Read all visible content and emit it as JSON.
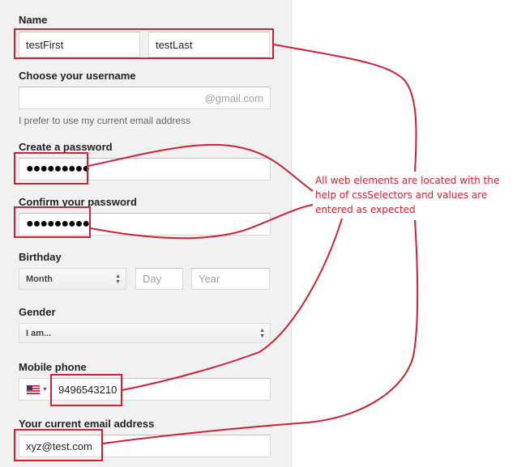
{
  "form": {
    "name": {
      "label": "Name",
      "first_value": "testFirst",
      "last_value": "testLast"
    },
    "username": {
      "label": "Choose your username",
      "suffix": "@gmail.com",
      "alt_link": "I prefer to use my current email address"
    },
    "password": {
      "label": "Create a password",
      "value": "●●●●●●●●●"
    },
    "confirm": {
      "label": "Confirm your password",
      "value": "●●●●●●●●●"
    },
    "birthday": {
      "label": "Birthday",
      "month": "Month",
      "day_placeholder": "Day",
      "year_placeholder": "Year"
    },
    "gender": {
      "label": "Gender",
      "value": "I am..."
    },
    "mobile": {
      "label": "Mobile phone",
      "value": "9496543210"
    },
    "email": {
      "label": "Your current email address",
      "value": "xyz@test.com"
    }
  },
  "annotation": {
    "text": "All web elements are located with the help of cssSelectors and values are entered as expected"
  },
  "colors": {
    "highlight": "#cc2233",
    "panel_bg": "#f1f1f1"
  }
}
